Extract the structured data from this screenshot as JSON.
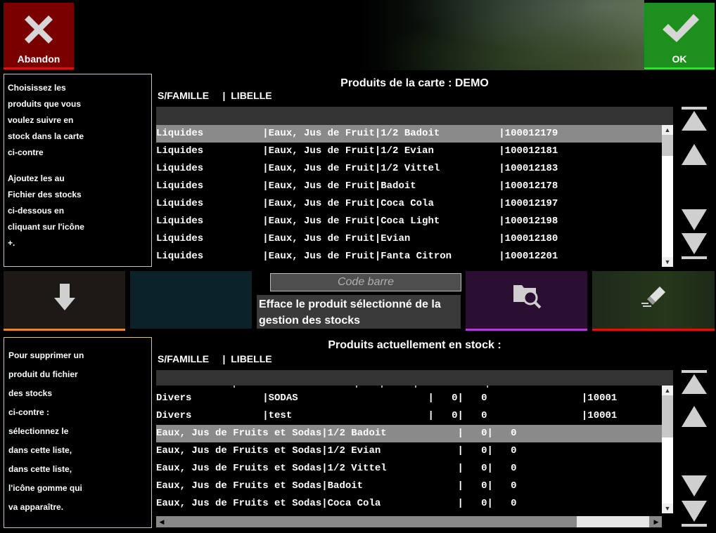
{
  "buttons": {
    "abandon_label": "Abandon",
    "ok_label": "OK"
  },
  "info_top": {
    "lines": [
      "Choisissez les",
      "produits que vous",
      "voulez suivre en",
      "stock dans la carte",
      "ci-contre"
    ],
    "lines2": [
      "Ajoutez les au",
      "Fichier des stocks",
      "ci-dessous en",
      "cliquant sur l'icône",
      "+."
    ]
  },
  "info_bottom": {
    "lines": [
      "Pour supprimer un",
      "produit du fichier",
      "des stocks",
      "ci-contre :",
      "sélectionnez le",
      "dans cette liste,",
      "dans cette liste,",
      "l'icône gomme qui",
      "va apparaître."
    ]
  },
  "top_list": {
    "title": "Produits de la carte : DEMO",
    "header": "S/FAMILLE     |  LIBELLE",
    "rows": [
      "Liquides          |Eaux, Jus de Fruit|1/2 Badoit          |100012179",
      "Liquides          |Eaux, Jus de Fruit|1/2 Evian           |100012181",
      "Liquides          |Eaux, Jus de Fruit|1/2 Vittel          |100012183",
      "Liquides          |Eaux, Jus de Fruit|Badoit              |100012178",
      "Liquides          |Eaux, Jus de Fruit|Coca Cola           |100012197",
      "Liquides          |Eaux, Jus de Fruit|Coca Light          |100012198",
      "Liquides          |Eaux, Jus de Fruit|Evian               |100012180",
      "Liquides          |Eaux, Jus de Fruit|Fanta Citron        |100012201"
    ],
    "selected_index": 0
  },
  "middle": {
    "barcode_placeholder": "Code barre",
    "erase_hint": "Efface le produit sélectionné de la gestion des stocks"
  },
  "bottom_list": {
    "title": "Produits actuellement en stock :",
    "header": "S/FAMILLE     |  LIBELLE",
    "partial_row": "                  |                            |     |       |                |",
    "rows": [
      "Divers            |SODAS                      |   0|   0                |10001",
      "Divers            |test                       |   0|   0                |10001",
      "Eaux, Jus de Fruits et Sodas|1/2 Badoit            |   0|   0",
      "Eaux, Jus de Fruits et Sodas|1/2 Evian             |   0|   0",
      "Eaux, Jus de Fruits et Sodas|1/2 Vittel            |   0|   0",
      "Eaux, Jus de Fruits et Sodas|Badoit                |   0|   0",
      "Eaux, Jus de Fruits et Sodas|Coca Cola             |   0|   0"
    ],
    "selected_index": 2
  },
  "colors": {
    "abandon": "#7a0000",
    "ok": "#1c8f1c",
    "selected_row": "#8a8a8a",
    "info_border": "#d8c87a"
  }
}
